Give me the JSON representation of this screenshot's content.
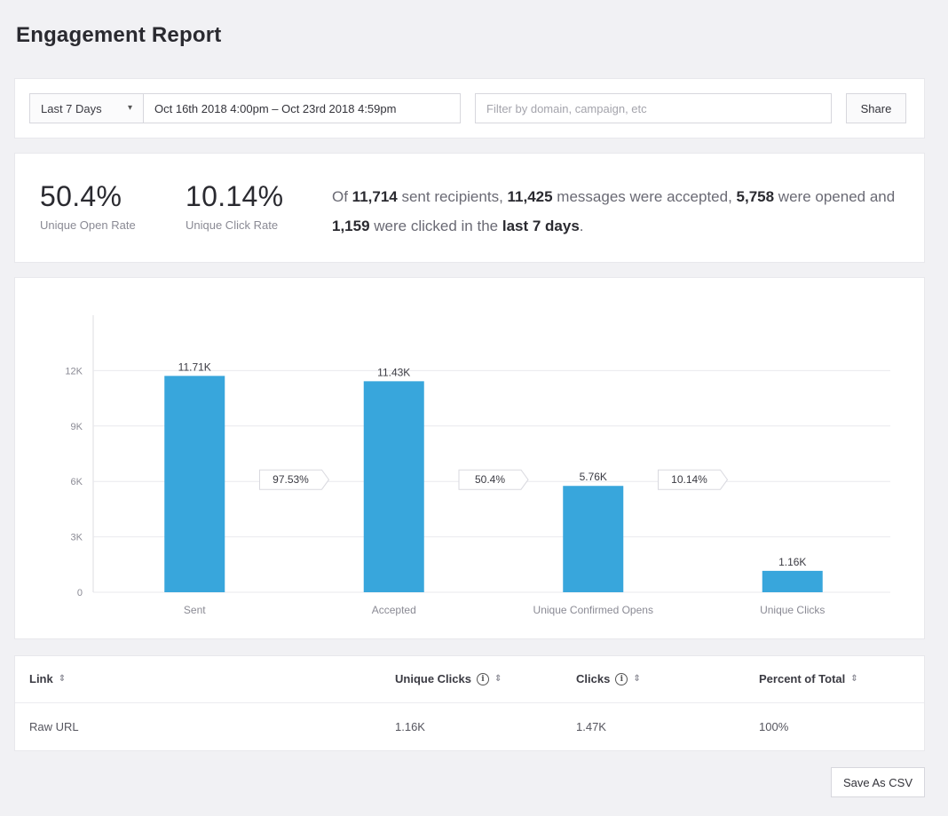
{
  "header": {
    "title": "Engagement Report"
  },
  "filters": {
    "range_label": "Last 7 Days",
    "date_range": "Oct 16th 2018 4:00pm – Oct 23rd 2018 4:59pm",
    "search_placeholder": "Filter by domain, campaign, etc",
    "share_label": "Share"
  },
  "summary": {
    "open_rate": "50.4%",
    "open_rate_label": "Unique Open Rate",
    "click_rate": "10.14%",
    "click_rate_label": "Unique Click Rate",
    "t1": "Of ",
    "sent": "11,714",
    "t2": " sent recipients, ",
    "accepted": "11,425",
    "t3": " messages were accepted, ",
    "opened": "5,758",
    "t4": " were opened and ",
    "clicked": "1,159",
    "t5": " were clicked in the ",
    "period": "last 7 days",
    "t6": "."
  },
  "chart_data": {
    "type": "bar",
    "categories": [
      "Sent",
      "Accepted",
      "Unique Confirmed Opens",
      "Unique Clicks"
    ],
    "values": [
      11714,
      11425,
      5758,
      1159
    ],
    "value_labels": [
      "11.71K",
      "11.43K",
      "5.76K",
      "1.16K"
    ],
    "conversion_labels": [
      "97.53%",
      "50.4%",
      "10.14%"
    ],
    "yticks": [
      0,
      3000,
      6000,
      9000,
      12000
    ],
    "ytick_labels": [
      "0",
      "3K",
      "6K",
      "9K",
      "12K"
    ],
    "ylim": [
      0,
      15000
    ],
    "grid": true,
    "bar_color": "#38a6dc"
  },
  "table": {
    "columns": [
      "Link",
      "Unique Clicks",
      "Clicks",
      "Percent of Total"
    ],
    "rows": [
      [
        "Raw URL",
        "1.16K",
        "1.47K",
        "100%"
      ]
    ]
  },
  "footer": {
    "csv_label": "Save As CSV"
  }
}
